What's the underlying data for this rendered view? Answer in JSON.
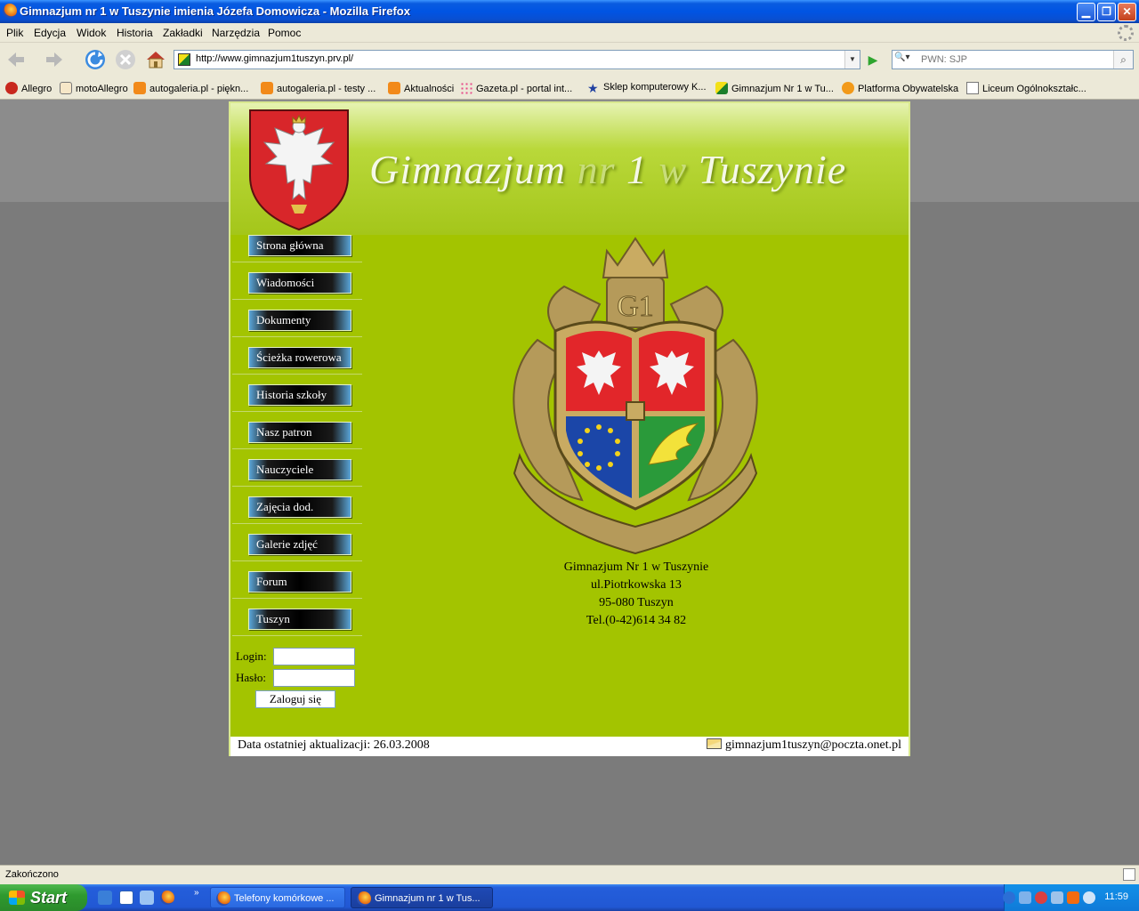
{
  "window": {
    "title": "Gimnazjum nr 1 w Tuszynie imienia Józefa Domowicza - Mozilla Firefox"
  },
  "menubar": [
    "Plik",
    "Edycja",
    "Widok",
    "Historia",
    "Zakładki",
    "Narzędzia",
    "Pomoc"
  ],
  "navbar": {
    "url": "http://www.gimnazjum1tuszyn.prv.pl/",
    "search_placeholder": "PWN: SJP"
  },
  "bookmarks": [
    "Allegro",
    "motoAllegro",
    "autogaleria.pl - piękn...",
    "autogaleria.pl - testy ...",
    "Aktualności",
    "Gazeta.pl - portal int...",
    "Sklep komputerowy K...",
    "Gimnazjum Nr 1 w Tu...",
    "Platforma Obywatelska",
    "Liceum Ogólnokształc..."
  ],
  "site": {
    "brand_part1": "Gimnazjum",
    "brand_part2": "nr",
    "brand_part3": "1",
    "brand_part4": "w",
    "brand_part5": "Tuszynie",
    "crest_monogram": "G1",
    "menu": [
      "Strona główna",
      "Wiadomości",
      "Dokumenty",
      "Ścieżka rowerowa",
      "Historia szkoły",
      "Nasz patron",
      "Nauczyciele",
      "Zajęcia dod.",
      "Galerie zdjęć",
      "Forum",
      "Tuszyn"
    ],
    "login": {
      "login_label": "Login:",
      "password_label": "Hasło:",
      "submit": "Zaloguj się"
    },
    "address": [
      "Gimnazjum Nr 1 w Tuszynie",
      "ul.Piotrkowska 13",
      "95-080 Tuszyn",
      "Tel.(0-42)614 34 82"
    ],
    "footer": {
      "updated": "Data ostatniej aktualizacji: 26.03.2008",
      "email": "gimnazjum1tuszyn@poczta.onet.pl"
    },
    "colors": {
      "page_green": "#a3c400",
      "header_light": "#e6f3b2"
    }
  },
  "statusbar": {
    "text": "Zakończono"
  },
  "taskbar": {
    "start": "Start",
    "tasks": [
      "Telefony komórkowe ...",
      "Gimnazjum nr 1 w Tus..."
    ],
    "clock": "11:59"
  }
}
